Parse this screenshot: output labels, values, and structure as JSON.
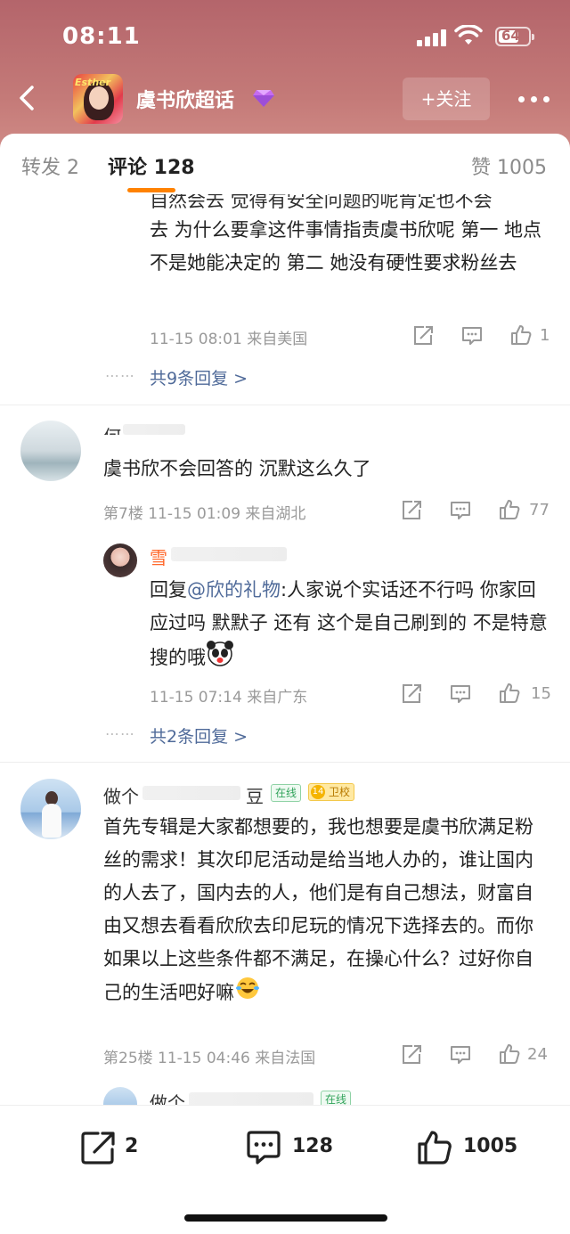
{
  "status_bar": {
    "time": "08:11",
    "battery": "64"
  },
  "nav": {
    "title": "虞书欣超话",
    "follow_label": "+关注",
    "avatar_text": "Esther"
  },
  "tabs": {
    "repost": "转发 2",
    "comment": "评论 128",
    "like": "赞 1005"
  },
  "comments": [
    {
      "text_partial_top": "自然会去 觉得有安全问题的呢肯定也不会",
      "text": "去 为什么要拿这件事情指责虞书欣呢 第一 地点不是她能决定的 第二 她没有硬性要求粉丝去",
      "meta": "11-15 08:01 来自美国",
      "likes": "1",
      "more_replies": "共9条回复 >"
    },
    {
      "username_partial": "何",
      "text": "虞书欣不会回答的 沉默这么久了",
      "meta": "第7楼 11-15 01:09 来自湖北",
      "likes": "77",
      "reply": {
        "username_partial": "雪",
        "prefix": "回复",
        "mention": "@欣的礼物",
        "text": ":人家说个实话还不行吗 你家回应过吗 默默子 还有 这个是自己刷到的 不是特意搜的哦",
        "meta": "11-15 07:14 来自广东",
        "likes": "15"
      },
      "more_replies": "共2条回复 >"
    },
    {
      "username_partial": "做个",
      "username_tail": "豆",
      "badge_online": "在线",
      "badge_level": "14",
      "badge_fan": "卫校",
      "text": "首先专辑是大家都想要的，我也想要是虞书欣满足粉丝的需求！其次印尼活动是给当地人办的，谁让国内的人去了，国内去的人，他们是有自己想法，财富自由又想去看看欣欣去印尼玩的情况下选择去的。而你如果以上这些条件都不满足，在操心什么？过好你自己的生活吧好嘛",
      "meta": "第25楼 11-15 04:46 来自法国",
      "likes": "24",
      "reply_username_partial": "做个",
      "reply_badge": "在线"
    }
  ],
  "bottom_bar": {
    "repost": "2",
    "comment": "128",
    "like": "1005"
  },
  "colors": {
    "accent": "#ff8200",
    "link": "#4f6a99",
    "hero": "#b4656b"
  }
}
